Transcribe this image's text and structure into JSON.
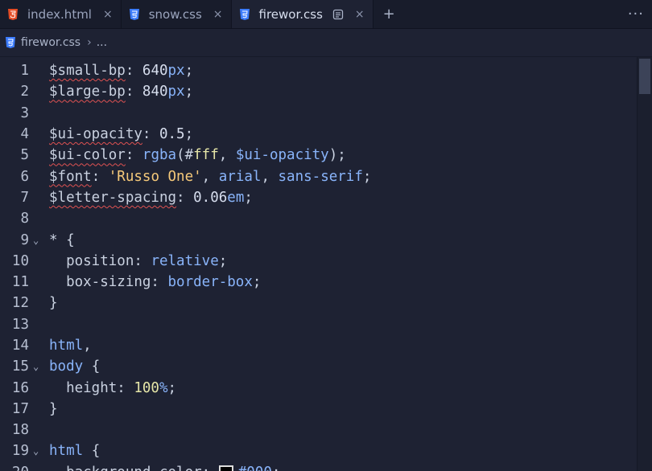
{
  "tabs": [
    {
      "label": "index.html",
      "icon": "html5-icon",
      "icon_color": "#e44d26",
      "active": false,
      "close": "×"
    },
    {
      "label": "snow.css",
      "icon": "css3-icon",
      "icon_color": "#3c7cff",
      "active": false,
      "close": "×"
    },
    {
      "label": "firewor.css",
      "icon": "css3-icon",
      "icon_color": "#3c7cff",
      "active": true,
      "close": "×"
    }
  ],
  "tab_add": "+",
  "more": "···",
  "breadcrumb": {
    "file": "firewor.css",
    "sep": "›",
    "rest": "..."
  },
  "lines": [
    {
      "num": "1",
      "fold": "",
      "tokens": [
        [
          "v",
          "$small-bp"
        ],
        [
          "p",
          ": "
        ],
        [
          "n",
          "640"
        ],
        [
          "u",
          "px"
        ],
        [
          "p",
          ";"
        ]
      ]
    },
    {
      "num": "2",
      "fold": "",
      "tokens": [
        [
          "v",
          "$large-bp"
        ],
        [
          "p",
          ": "
        ],
        [
          "n",
          "840"
        ],
        [
          "u",
          "px"
        ],
        [
          "p",
          ";"
        ]
      ]
    },
    {
      "num": "3",
      "fold": "",
      "tokens": []
    },
    {
      "num": "4",
      "fold": "",
      "tokens": [
        [
          "v",
          "$ui-opacity"
        ],
        [
          "p",
          ": "
        ],
        [
          "n",
          "0.5"
        ],
        [
          "p",
          ";"
        ]
      ]
    },
    {
      "num": "5",
      "fold": "",
      "tokens": [
        [
          "v",
          "$ui-color"
        ],
        [
          "p",
          ": "
        ],
        [
          "kw",
          "rgba"
        ],
        [
          "p",
          "(#"
        ],
        [
          "num",
          "fff"
        ],
        [
          "p",
          ", "
        ],
        [
          "var",
          "$ui-opacity"
        ],
        [
          "p",
          ");"
        ]
      ]
    },
    {
      "num": "6",
      "fold": "",
      "tokens": [
        [
          "v",
          "$font"
        ],
        [
          "p",
          ": "
        ],
        [
          "str",
          "'Russo One'"
        ],
        [
          "p",
          ", "
        ],
        [
          "kw",
          "arial"
        ],
        [
          "p",
          ", "
        ],
        [
          "kw",
          "sans-serif"
        ],
        [
          "p",
          ";"
        ]
      ]
    },
    {
      "num": "7",
      "fold": "",
      "tokens": [
        [
          "v",
          "$letter-spacing"
        ],
        [
          "p",
          ": "
        ],
        [
          "n",
          "0.06"
        ],
        [
          "u",
          "em"
        ],
        [
          "p",
          ";"
        ]
      ]
    },
    {
      "num": "8",
      "fold": "",
      "tokens": []
    },
    {
      "num": "9",
      "fold": "⌄",
      "tokens": [
        [
          "p",
          "* {"
        ]
      ]
    },
    {
      "num": "10",
      "fold": "",
      "tokens": [
        [
          "p",
          "  position: "
        ],
        [
          "kw",
          "relative"
        ],
        [
          "p",
          ";"
        ]
      ]
    },
    {
      "num": "11",
      "fold": "",
      "tokens": [
        [
          "p",
          "  box-sizing: "
        ],
        [
          "kw",
          "border-box"
        ],
        [
          "p",
          ";"
        ]
      ]
    },
    {
      "num": "12",
      "fold": "",
      "tokens": [
        [
          "p",
          "}"
        ]
      ]
    },
    {
      "num": "13",
      "fold": "",
      "tokens": []
    },
    {
      "num": "14",
      "fold": "",
      "tokens": [
        [
          "kw",
          "html"
        ],
        [
          "p",
          ","
        ]
      ]
    },
    {
      "num": "15",
      "fold": "⌄",
      "tokens": [
        [
          "kw",
          "body"
        ],
        [
          "p",
          " {"
        ]
      ]
    },
    {
      "num": "16",
      "fold": "",
      "tokens": [
        [
          "p",
          "  height: "
        ],
        [
          "num",
          "100"
        ],
        [
          "u",
          "%"
        ],
        [
          "p",
          ";"
        ]
      ]
    },
    {
      "num": "17",
      "fold": "",
      "tokens": [
        [
          "p",
          "}"
        ]
      ]
    },
    {
      "num": "18",
      "fold": "",
      "tokens": []
    },
    {
      "num": "19",
      "fold": "⌄",
      "tokens": [
        [
          "kw",
          "html"
        ],
        [
          "p",
          " {"
        ]
      ]
    },
    {
      "num": "20",
      "fold": "",
      "tokens": [
        [
          "p",
          "  background-color: "
        ],
        [
          "swatch",
          "#000"
        ],
        [
          "var",
          "#000"
        ],
        [
          "p",
          ";"
        ]
      ]
    }
  ]
}
